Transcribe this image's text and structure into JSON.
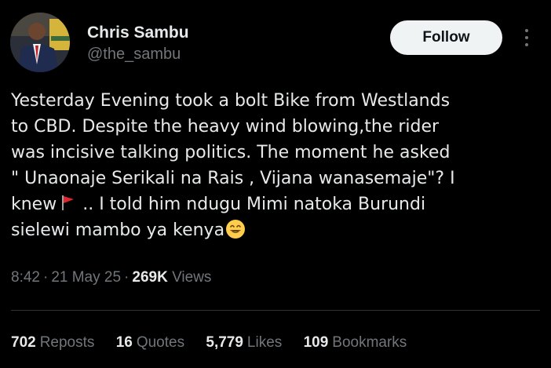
{
  "author": {
    "name": "Chris Sambu",
    "handle": "@the_sambu"
  },
  "actions": {
    "follow_label": "Follow",
    "more_icon": "more-vertical-icon"
  },
  "post": {
    "lines": [
      "Yesterday Evening took a bolt Bike from Westlands",
      "to CBD. Despite the  heavy wind blowing,the rider",
      "was incisive talking politics. The moment he asked",
      "\" Unaonaje Serikali na Rais , Vijana wanasemaje\"?  I"
    ],
    "line5_before_flag": "knew",
    "flag_icon": "red-flag-icon",
    "line5_after_flag": " .. I told him ndugu Mimi natoka Burundi",
    "line6": "sielewi mambo ya kenya",
    "emoji_icon": "grinning-face-icon"
  },
  "meta": {
    "time": "8:42",
    "date": "21 May 25",
    "views_count": "269K",
    "views_label": "Views",
    "separator": "·"
  },
  "stats": [
    {
      "count": "702",
      "label": "Reposts"
    },
    {
      "count": "16",
      "label": "Quotes"
    },
    {
      "count": "5,779",
      "label": "Likes"
    },
    {
      "count": "109",
      "label": "Bookmarks"
    }
  ],
  "colors": {
    "background": "#000000",
    "primary_text": "#e7e9ea",
    "secondary_text": "#71767b",
    "follow_button_bg": "#eff3f4",
    "divider": "#2f3336",
    "flag_red": "#e0262e",
    "emoji_yellow": "#ffcc4d"
  }
}
